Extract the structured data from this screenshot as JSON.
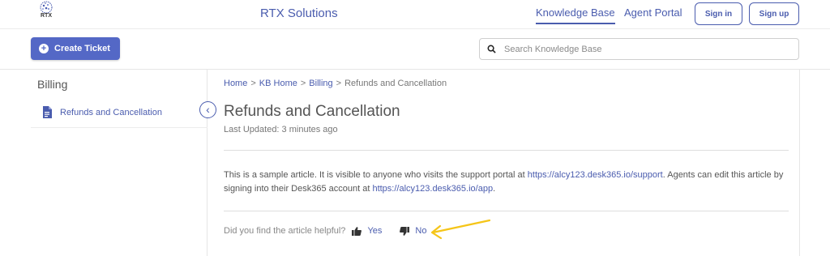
{
  "header": {
    "logo_text": "RTX",
    "brand": "RTX Solutions",
    "nav": {
      "knowledge_base": "Knowledge Base",
      "agent_portal": "Agent Portal"
    },
    "sign_in": "Sign in",
    "sign_up": "Sign up"
  },
  "toolbar": {
    "create_ticket": "Create Ticket",
    "search_placeholder": "Search Knowledge Base"
  },
  "sidebar": {
    "title": "Billing",
    "items": [
      {
        "label": "Refunds and Cancellation",
        "icon": "document-icon"
      }
    ]
  },
  "breadcrumb": {
    "home": "Home",
    "kb_home": "KB Home",
    "billing": "Billing",
    "current": "Refunds and Cancellation",
    "separator": ">"
  },
  "article": {
    "title": "Refunds and Cancellation",
    "last_updated": "Last Updated: 3 minutes ago",
    "body_part1": "This is a sample article. It is visible to anyone who visits the support portal at ",
    "link1": "https://alcy123.desk365.io/support",
    "body_part2": ". Agents can edit this article by signing into their Desk365 account at ",
    "link2": "https://alcy123.desk365.io/app",
    "body_part3": "."
  },
  "feedback": {
    "question": "Did you find the article helpful?",
    "yes": "Yes",
    "no": "No"
  },
  "colors": {
    "accent": "#4a5cae",
    "button_fill": "#5468c6",
    "annotation_arrow": "#f5c518"
  }
}
